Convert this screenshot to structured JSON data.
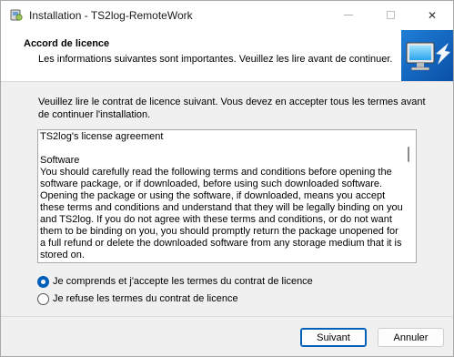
{
  "window": {
    "title": "Installation - TS2log-RemoteWork",
    "close_glyph": "✕"
  },
  "header": {
    "title": "Accord de licence",
    "subtitle": "Les informations suivantes sont importantes. Veuillez les lire avant de continuer."
  },
  "main": {
    "intro": "Veuillez lire le contrat de licence suivant. Vous devez en accepter tous les termes avant de continuer l'installation.",
    "license_text": "TS2log's license agreement\n\nSoftware\nYou should carefully read the following terms and conditions before opening the software package, or if downloaded, before using such downloaded software. Opening the package or using the software, if downloaded, means you accept these terms and conditions and understand that they will be legally binding on you and TS2log. If you do not agree with these terms and conditions, or do not want them to be binding on you, you should promptly return the package unopened for a full refund or delete the downloaded software from any storage medium that it is stored on.",
    "accept_label": "Je comprends et j'accepte les termes du contrat de licence",
    "refuse_label": "Je refuse les termes du contrat de licence",
    "selected": "accept"
  },
  "footer": {
    "next_label": "Suivant",
    "cancel_label": "Annuler"
  },
  "colors": {
    "accent": "#005fb8"
  },
  "icons": [
    "installer-icon",
    "minimize-icon",
    "maximize-icon",
    "close-icon",
    "setup-monitor-graphic"
  ]
}
